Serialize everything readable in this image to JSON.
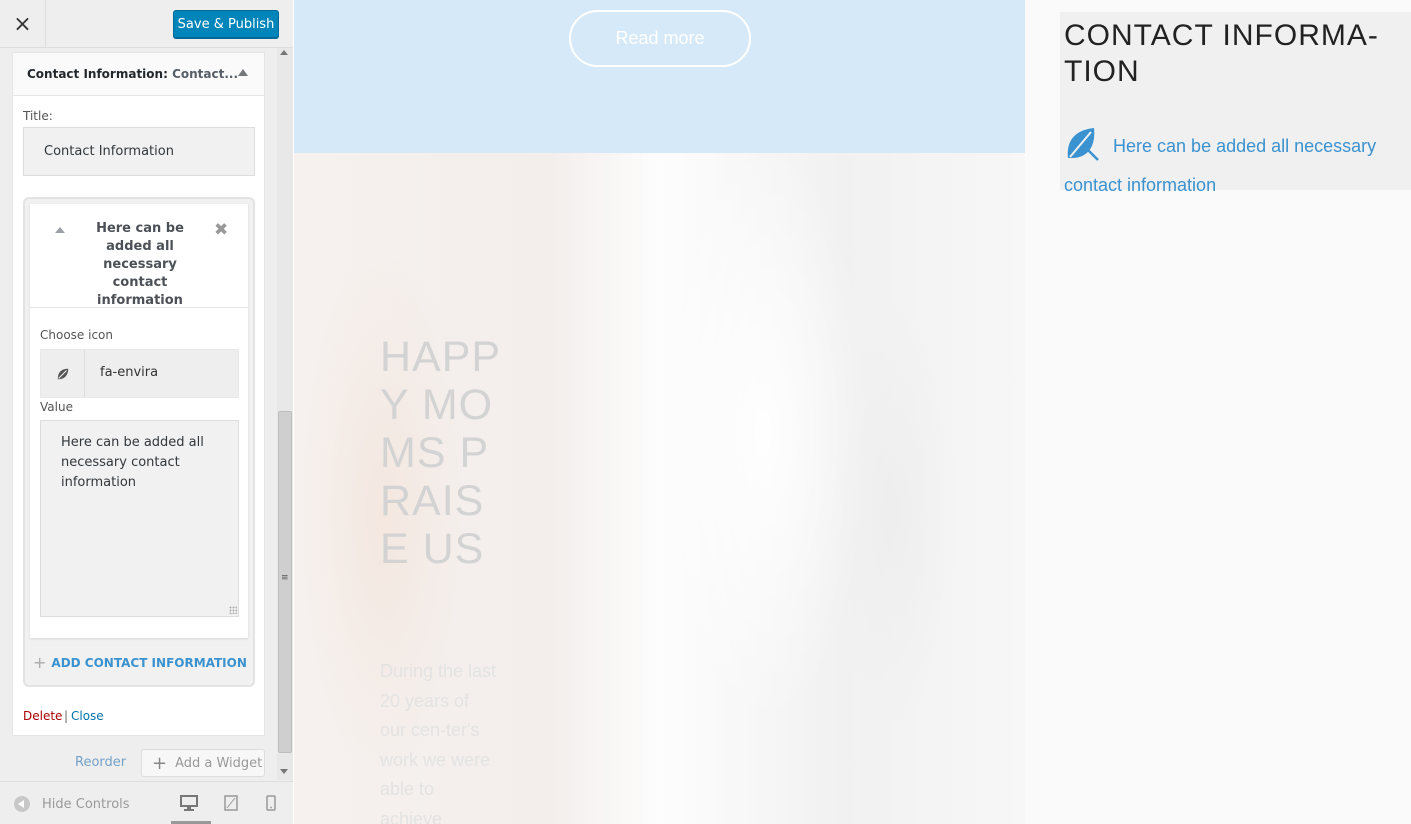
{
  "toolbar": {
    "close_symbol": "×",
    "save_label": "Save & Publish"
  },
  "widget": {
    "title_main": "Contact Information:",
    "title_sub": "Contact...",
    "title_field_label": "Title:",
    "title_value": "Contact Information"
  },
  "contact_item": {
    "header": "Here can be added all necessary contact information",
    "icon_label": "Choose icon",
    "icon_name": "leaf-icon",
    "icon_value": "fa-envira",
    "value_label": "Value",
    "value_text": "Here can be added all necessary contact information"
  },
  "actions": {
    "add_contact": "ADD CONTACT INFORMATION",
    "delete": "Delete",
    "separator": "|",
    "close": "Close",
    "reorder": "Reorder",
    "add_widget": "Add a Widget"
  },
  "footer": {
    "hide_controls": "Hide Controls"
  },
  "preview": {
    "read_more": "Read more",
    "hero_title": "HAPPY MOMS PRAISE US",
    "hero_text": "During the last 20 years of our cen-ter's work we were able to achieve"
  },
  "right_widget": {
    "heading": "CONTACT INFORMA-TION",
    "line": "Here can be added all necessary contact information"
  },
  "colors": {
    "accent": "#0085ba",
    "link_blue": "#3a92d0",
    "delete_red": "#aa0000",
    "hero_band": "#d6e9f8"
  }
}
